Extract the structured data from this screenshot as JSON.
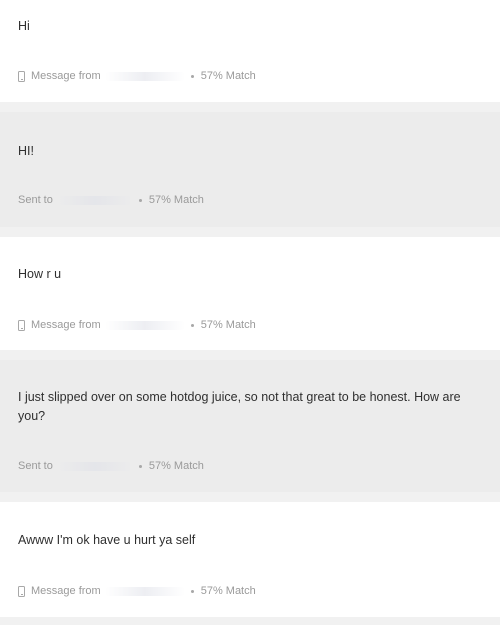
{
  "messages": [
    {
      "direction": "received",
      "text": "Hi",
      "meta_label": "Message from",
      "match": "57% Match",
      "icon": "phone-icon"
    },
    {
      "direction": "sent",
      "text": "HI!",
      "meta_label": "Sent to",
      "match": "57% Match"
    },
    {
      "direction": "received",
      "text": "How r u",
      "meta_label": "Message from",
      "match": "57% Match",
      "icon": "phone-icon"
    },
    {
      "direction": "sent",
      "text": "I just slipped over on some hotdog juice, so not that great to be honest. How are you?",
      "meta_label": "Sent to",
      "match": "57% Match"
    },
    {
      "direction": "received",
      "text": "Awww I'm ok have u hurt ya self",
      "meta_label": "Message from",
      "match": "57% Match",
      "icon": "phone-icon"
    }
  ],
  "colors": {
    "received_bg": "#ffffff",
    "sent_bg": "#ececec",
    "page_bg": "#f1f1f1",
    "text": "#2f2f2f",
    "meta_text": "#9a9a9a"
  }
}
